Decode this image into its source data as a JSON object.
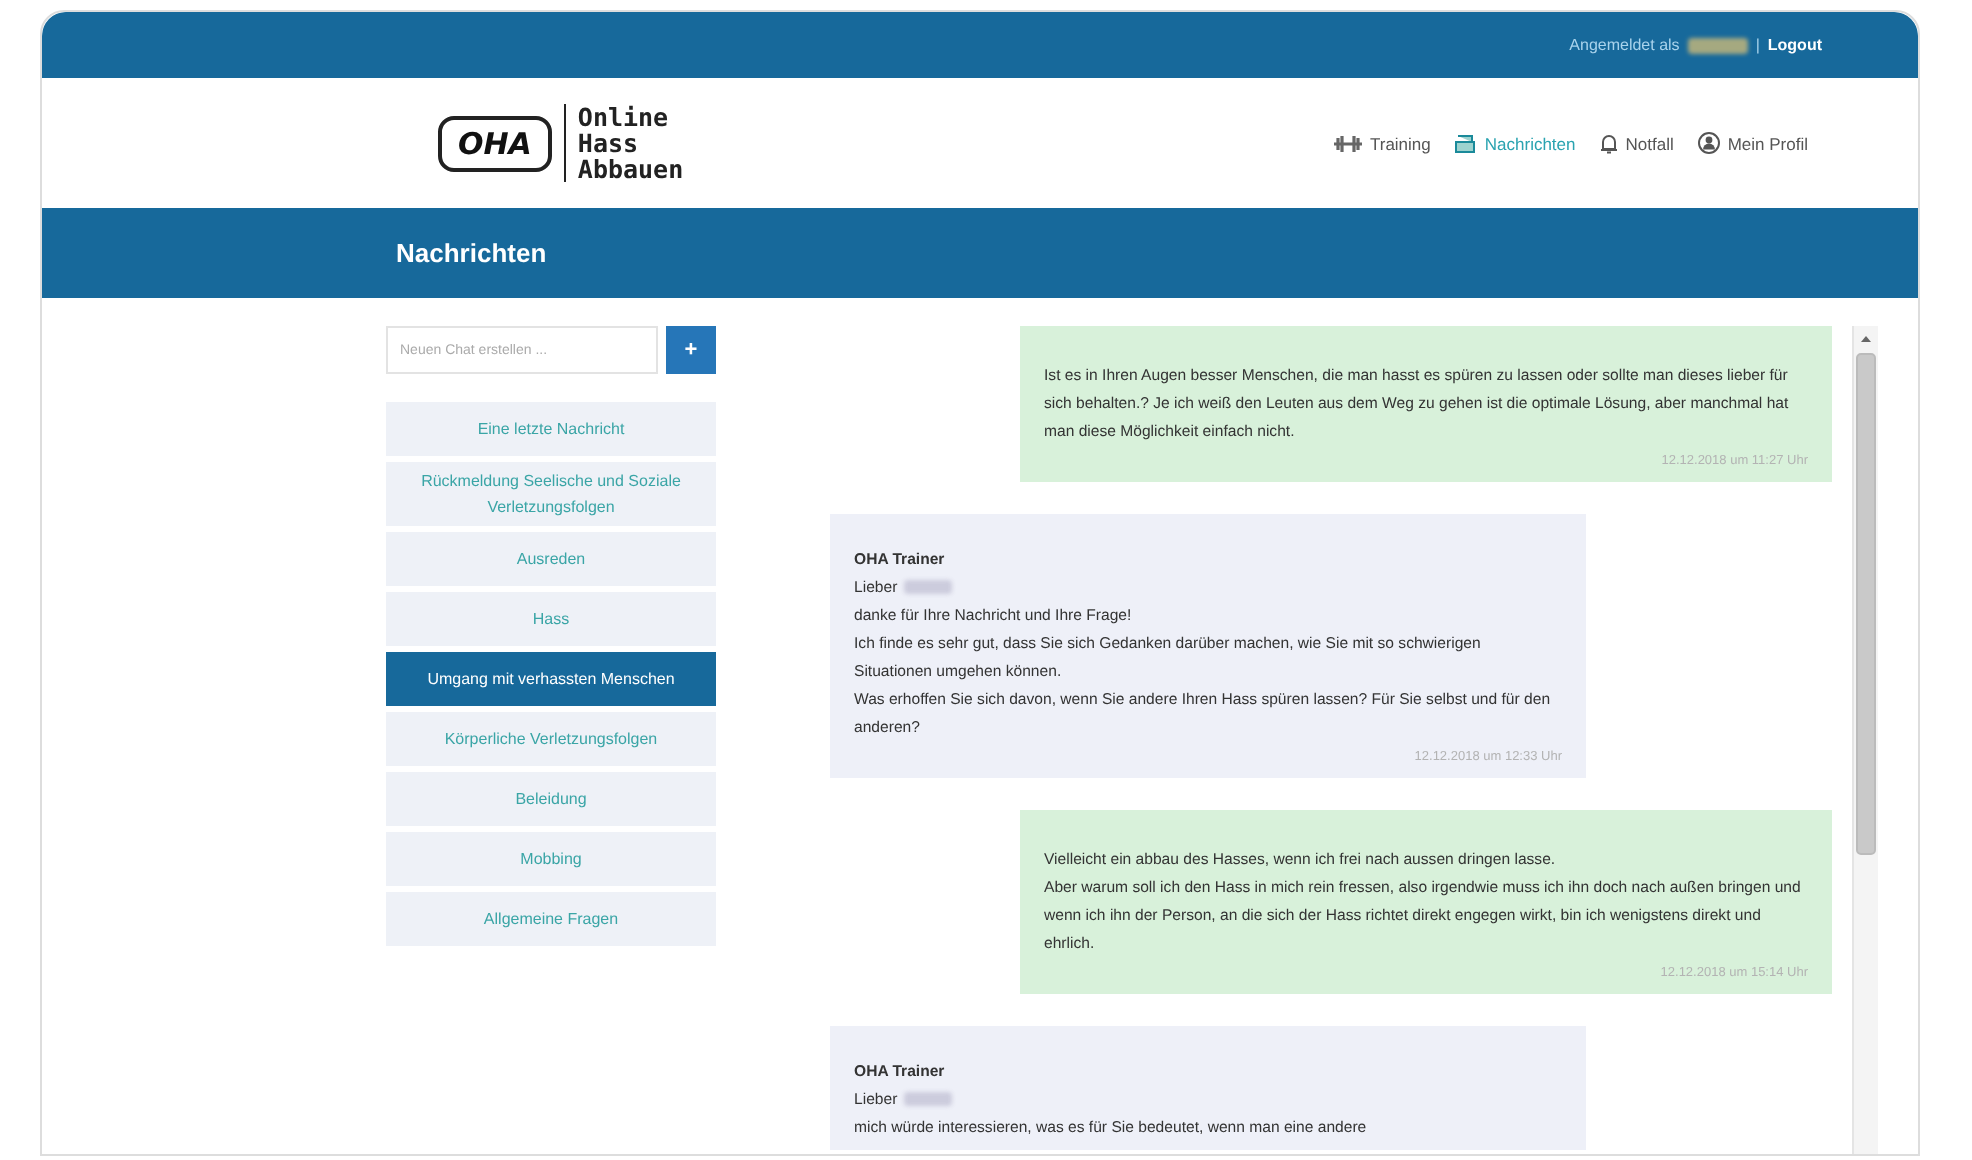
{
  "top_bar": {
    "logged_in_label": "Angemeldet als",
    "separator": "|",
    "logout": "Logout"
  },
  "header": {
    "logo_mark": "OHA",
    "logo_lines": [
      "Online",
      "Hass",
      "Abbauen"
    ],
    "nav": [
      {
        "label": "Training",
        "kind": "training",
        "selected": false
      },
      {
        "label": "Nachrichten",
        "kind": "messages",
        "selected": true
      },
      {
        "label": "Notfall",
        "kind": "emergency",
        "selected": false
      },
      {
        "label": "Mein Profil",
        "kind": "profile",
        "selected": false
      }
    ]
  },
  "page_title": "Nachrichten",
  "sidebar": {
    "new_chat": {
      "placeholder": "Neuen Chat erstellen ...",
      "button": "+"
    },
    "items": [
      {
        "label": "Eine letzte Nachricht",
        "selected": false
      },
      {
        "label": "Rückmeldung Seelische und Soziale Verletzungsfolgen",
        "selected": false
      },
      {
        "label": "Ausreden",
        "selected": false
      },
      {
        "label": "Hass",
        "selected": false
      },
      {
        "label": "Umgang mit verhassten Menschen",
        "selected": true
      },
      {
        "label": "Körperliche Verletzungsfolgen",
        "selected": false
      },
      {
        "label": "Beleidung",
        "selected": false
      },
      {
        "label": "Mobbing",
        "selected": false
      },
      {
        "label": "Allgemeine Fragen",
        "selected": false
      }
    ]
  },
  "messages": [
    {
      "kind": "sent",
      "lines": [
        "Ist es in Ihren Augen besser Menschen, die man hasst es spüren zu lassen oder sollte man dieses lieber für sich behalten.? Je ich weiß den Leuten aus dem Weg zu gehen ist die optimale Lösung, aber manchmal hat man diese Möglichkeit einfach nicht."
      ],
      "time": "12.12.2018 um 11:27 Uhr"
    },
    {
      "kind": "received",
      "sender": "OHA Trainer",
      "greeting": "Lieber",
      "lines": [
        "danke für Ihre Nachricht und Ihre Frage!",
        "Ich finde es sehr gut, dass Sie sich Gedanken darüber machen, wie Sie mit so schwierigen Situationen umgehen können.",
        "Was erhoffen Sie sich davon, wenn Sie andere Ihren Hass spüren lassen? Für Sie selbst und für den anderen?"
      ],
      "time": "12.12.2018 um 12:33 Uhr"
    },
    {
      "kind": "sent",
      "lines": [
        "Vielleicht ein abbau des Hasses, wenn ich frei nach aussen dringen lasse.",
        "Aber warum soll ich den Hass in mich rein fressen, also irgendwie muss ich ihn doch nach außen bringen und wenn ich ihn der Person, an die sich der Hass richtet direkt engegen wirkt, bin ich wenigstens direkt und ehrlich."
      ],
      "time": "12.12.2018 um 15:14 Uhr"
    },
    {
      "kind": "received",
      "sender": "OHA Trainer",
      "greeting": "Lieber",
      "lines": [
        "mich würde interessieren, was es für Sie bedeutet, wenn man eine andere"
      ]
    }
  ]
}
